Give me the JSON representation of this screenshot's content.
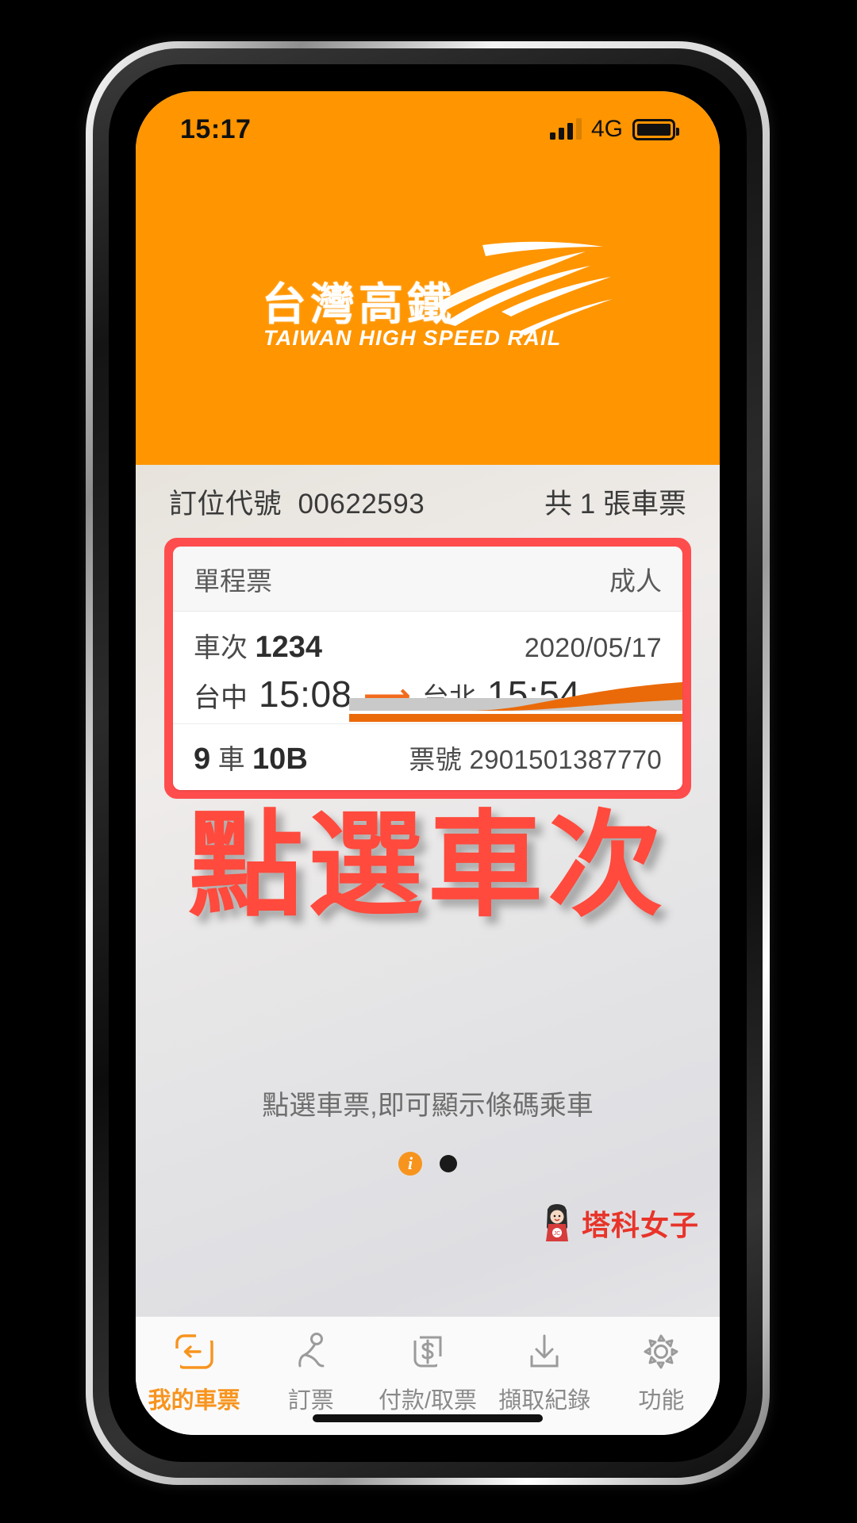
{
  "status_bar": {
    "time": "15:17",
    "network": "4G",
    "signal_icon": "signal-bars-icon",
    "battery_icon": "battery-full-icon"
  },
  "header": {
    "logo_cn": "台灣高鐵",
    "logo_en": "TAIWAN HIGH SPEED RAIL",
    "logo_mark": "thsr-swoosh-icon",
    "background_color": "#FF9500"
  },
  "booking": {
    "code_label": "訂位代號",
    "code_value": "00622593",
    "ticket_count": "共 1 張車票"
  },
  "ticket": {
    "type": "單程票",
    "passenger_type": "成人",
    "train_label": "車次",
    "train_number": "1234",
    "date": "2020/05/17",
    "from_station": "台中",
    "depart_time": "15:08",
    "arrow_icon": "arrow-right-icon",
    "to_station": "台北",
    "arrive_time": "15:54",
    "car_number": "9",
    "car_unit": "車",
    "seat": "10B",
    "ticket_no_label": "票號",
    "ticket_no": "2901501387770",
    "highlight_color": "#FF4D4D",
    "train_art_icon": "train-nose-illustration"
  },
  "overlay": {
    "annotation": "點選車次",
    "color": "#FF4A3D"
  },
  "hint": {
    "text": "點選車票,即可顯示條碼乘車"
  },
  "pager": {
    "info_dot": "i",
    "dots": 2,
    "active_index": 0
  },
  "watermark": {
    "avatar_icon": "girl-avatar-icon",
    "text": "塔科女子",
    "color": "#E8342A"
  },
  "tabbar": {
    "items": [
      {
        "label": "我的車票",
        "icon": "my-ticket-icon",
        "active": true
      },
      {
        "label": "訂票",
        "icon": "seat-booking-icon",
        "active": false
      },
      {
        "label": "付款/取票",
        "icon": "payment-dollar-icon",
        "active": false
      },
      {
        "label": "擷取紀錄",
        "icon": "download-record-icon",
        "active": false
      },
      {
        "label": "功能",
        "icon": "gear-icon",
        "active": false
      }
    ],
    "active_color": "#F7941E"
  }
}
